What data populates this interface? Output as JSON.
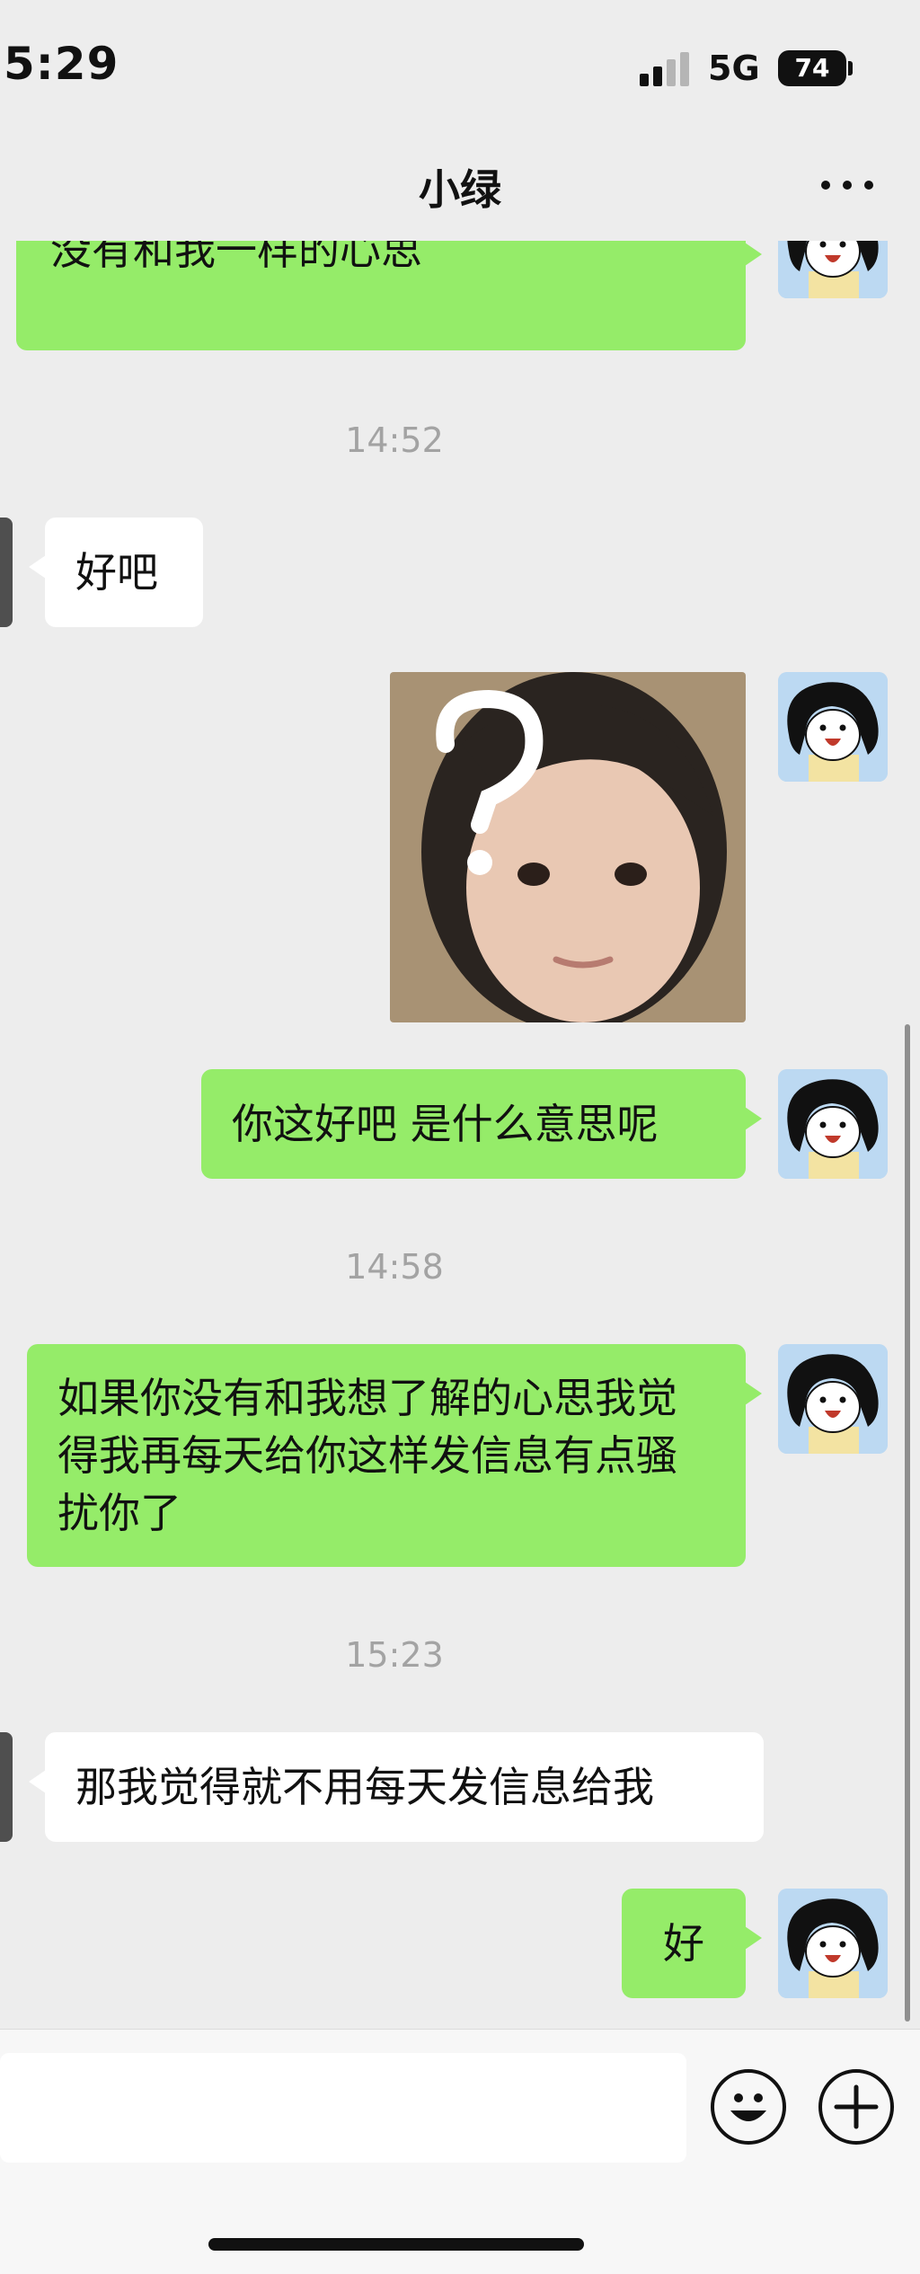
{
  "status_bar": {
    "time": "5:29",
    "network": "5G",
    "battery": "74"
  },
  "nav": {
    "title": "小绿",
    "more_icon": "more-dots-icon"
  },
  "messages": [
    {
      "type": "text",
      "from": "me",
      "text": "想和你多一点了解 但是感觉你好像没有和我一样的心思"
    },
    {
      "type": "time",
      "text": "14:52"
    },
    {
      "type": "text",
      "from": "them",
      "text": "好吧"
    },
    {
      "type": "image",
      "from": "me",
      "caption": "?"
    },
    {
      "type": "text",
      "from": "me",
      "text": "你这好吧 是什么意思呢"
    },
    {
      "type": "time",
      "text": "14:58"
    },
    {
      "type": "text",
      "from": "me",
      "text": "如果你没有和我想了解的心思我觉得我再每天给你这样发信息有点骚扰你了"
    },
    {
      "type": "time",
      "text": "15:23"
    },
    {
      "type": "text",
      "from": "them",
      "text": "那我觉得就不用每天发信息给我"
    },
    {
      "type": "text",
      "from": "me",
      "text": "好"
    }
  ],
  "input_bar": {
    "placeholder": "",
    "emoji_icon": "emoji-icon",
    "plus_icon": "plus-icon"
  },
  "colors": {
    "me_bubble": "#95ec69",
    "them_bubble": "#ffffff",
    "background": "#ededed"
  }
}
